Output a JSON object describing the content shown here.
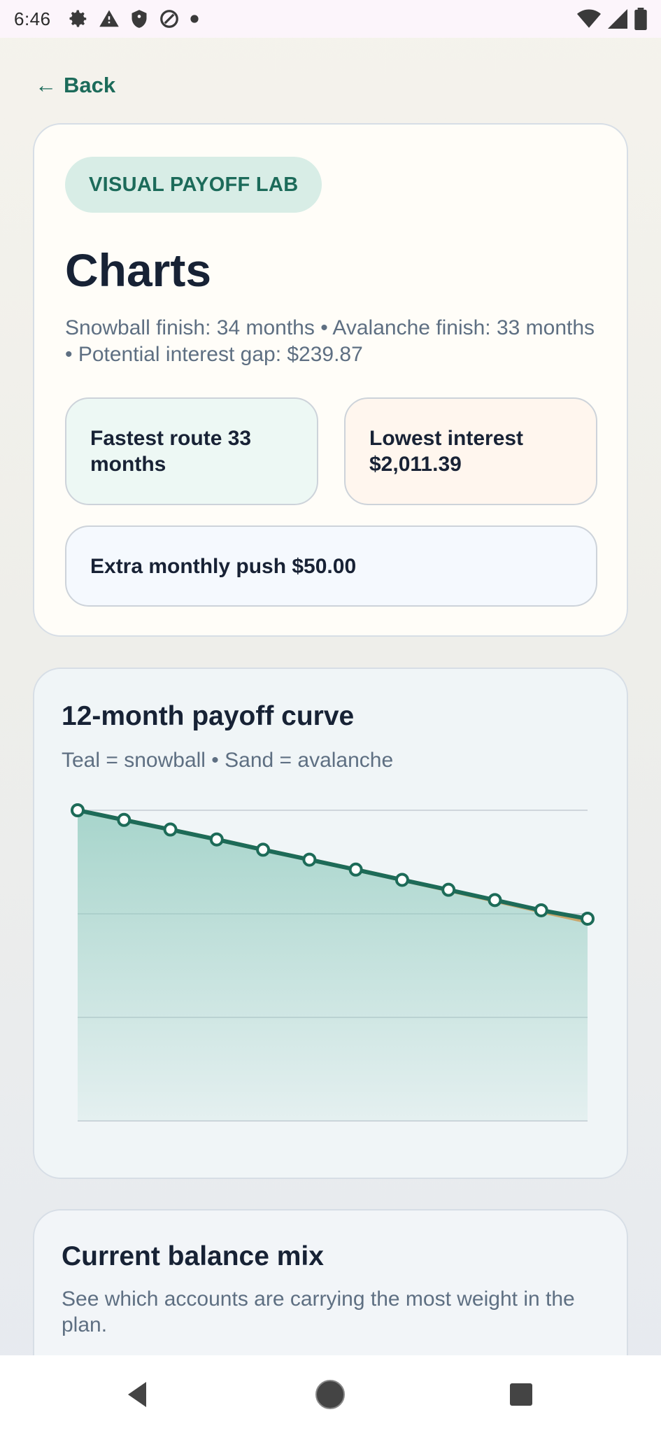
{
  "status_bar": {
    "time": "6:46",
    "left_icons": [
      "gear-icon",
      "warning-icon",
      "shield-icon",
      "blocked-icon",
      "dot-icon"
    ],
    "right_icons": [
      "wifi-icon",
      "signal-icon",
      "battery-icon"
    ]
  },
  "back": {
    "arrow": "←",
    "label": "Back"
  },
  "hero": {
    "badge": "VISUAL PAYOFF LAB",
    "title": "Charts",
    "summary": "Snowball finish: 34 months • Avalanche finish: 33 months • Potential interest gap: $239.87",
    "fastest": "Fastest route 33 months",
    "lowest": "Lowest interest $2,011.39",
    "extra": "Extra monthly push $50.00"
  },
  "payoff_chart": {
    "title": "12-month payoff curve",
    "subtitle": "Teal = snowball • Sand = avalanche",
    "colors": {
      "snowball": "#1d6b58",
      "avalanche": "#c9a66b",
      "fill": "#8fcabd",
      "grid": "#cfd6dc"
    }
  },
  "chart_data": {
    "type": "line",
    "x": [
      1,
      2,
      3,
      4,
      5,
      6,
      7,
      8,
      9,
      10,
      11,
      12
    ],
    "series": [
      {
        "values": [
          100,
          96.9,
          93.8,
          90.6,
          87.3,
          84.1,
          80.9,
          77.6,
          74.4,
          71.1,
          67.8,
          65.1
        ]
      },
      {
        "values": [
          100,
          96.9,
          93.8,
          90.6,
          87.3,
          84.1,
          80.9,
          77.6,
          74.3,
          70.9,
          67.5,
          64.2
        ]
      }
    ],
    "ylim": [
      0,
      100
    ],
    "grid": true,
    "gridlines": 4
  },
  "balance_mix": {
    "title": "Current balance mix",
    "subtitle": "See which accounts are carrying the most weight in the plan."
  },
  "nav": {
    "icons": [
      "back-triangle-icon",
      "home-circle-icon",
      "recents-square-icon"
    ]
  }
}
